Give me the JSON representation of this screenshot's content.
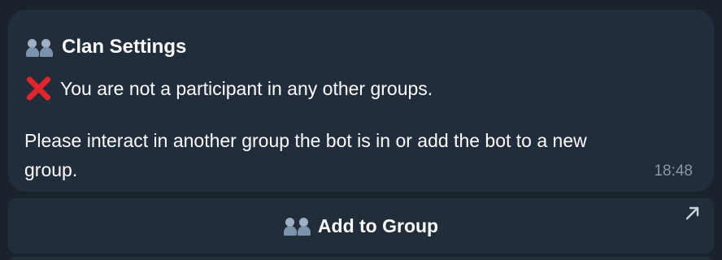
{
  "message": {
    "title": "Clan Settings",
    "title_icon": "group-icon",
    "error_icon": "cross-mark-icon",
    "error_text": "You are not a participant in any other groups.",
    "info_line_1": "Please interact in another group the bot is in or add the bot to a new",
    "info_line_2": "group.",
    "time": "18:48"
  },
  "inline_button": {
    "label": "Add to Group",
    "icon": "group-icon",
    "corner_icon": "external-link-arrow-icon"
  },
  "colors": {
    "bubble_bg": "#212d3b",
    "chat_bg": "#1a222c",
    "error_red": "#e0252c",
    "timestamp": "#8a97a6"
  }
}
